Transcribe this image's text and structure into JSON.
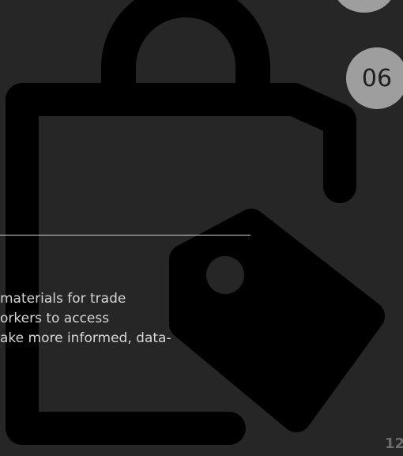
{
  "slide": {
    "badge_number": "06",
    "body_lines": [
      "materials for trade",
      "orkers to access",
      "ake more informed, data-"
    ],
    "page_number": "12"
  },
  "graphic": {
    "icon": "shopping-bag-with-price-tag-icon",
    "color": "#000000"
  },
  "colors": {
    "background": "#262626",
    "badge": "#9e9e9e",
    "text": "#d6d6d6",
    "divider": "#cfcfcf",
    "page_number": "#6c6c6c"
  }
}
